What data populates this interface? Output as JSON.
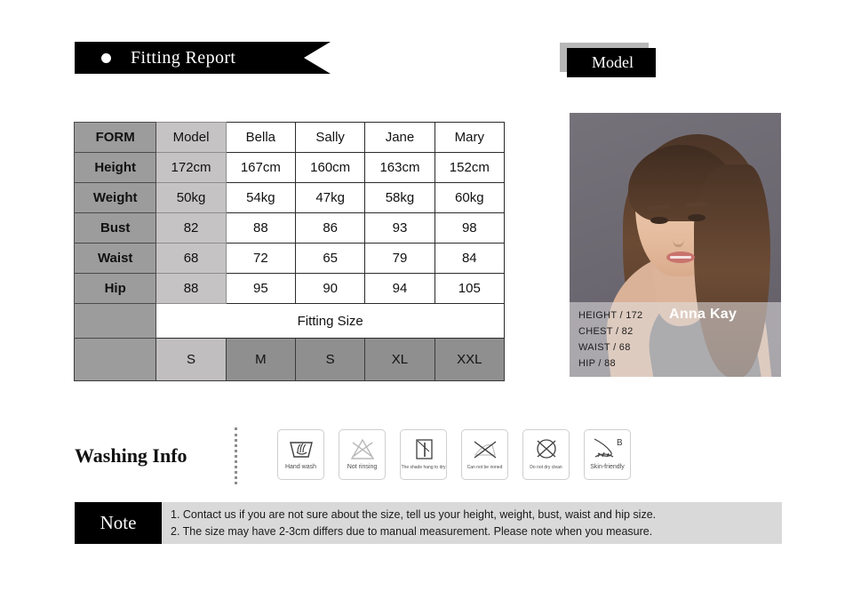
{
  "header": {
    "fitting_report_label": "Fitting Report",
    "model_label": "Model"
  },
  "size_table": {
    "columns": [
      "FORM",
      "Model",
      "Bella",
      "Sally",
      "Jane",
      "Mary"
    ],
    "rows": [
      {
        "label": "Height",
        "values": [
          "172cm",
          "167cm",
          "160cm",
          "163cm",
          "152cm"
        ]
      },
      {
        "label": "Weight",
        "values": [
          "50kg",
          "54kg",
          "47kg",
          "58kg",
          "60kg"
        ]
      },
      {
        "label": "Bust",
        "values": [
          "82",
          "88",
          "86",
          "93",
          "98"
        ]
      },
      {
        "label": "Waist",
        "values": [
          "68",
          "72",
          "65",
          "79",
          "84"
        ]
      },
      {
        "label": "Hip",
        "values": [
          "88",
          "95",
          "90",
          "94",
          "105"
        ]
      }
    ],
    "fitting_size_title": "Fitting Size",
    "fitting_sizes": [
      "S",
      "M",
      "S",
      "XL",
      "XXL"
    ]
  },
  "model_card": {
    "name": "Anna Kay",
    "measurements": [
      "HEIGHT /  172",
      "CHEST /  82",
      "WAIST /  68",
      "HIP /  88"
    ]
  },
  "washing": {
    "title": "Washing Info",
    "icons": [
      {
        "icon": "hand-wash-icon",
        "caption": "Hand wash"
      },
      {
        "icon": "not-rinsing-icon",
        "caption": "Not rinsing"
      },
      {
        "icon": "shade-hang-dry-icon",
        "caption": "The shade hang to dry"
      },
      {
        "icon": "do-not-iron-icon",
        "caption": "Can not be ironed"
      },
      {
        "icon": "do-not-dry-clean-icon",
        "caption": "Do not dry clean"
      },
      {
        "icon": "skin-friendly-icon",
        "caption": "Skin-friendly",
        "badge": "B"
      }
    ]
  },
  "note": {
    "label": "Note",
    "lines": [
      "1. Contact us if you are not sure about the size, tell us your height, weight, bust, waist and hip size.",
      "2. The size may have 2-3cm differs due to manual measurement. Please note when you measure."
    ]
  },
  "colors": {
    "banner": "#000000",
    "label_cell": "#9c9c9c",
    "model_cell": "#c5c3c3",
    "size_cell": "#8f8f8f",
    "note_bg": "#d9d9d9"
  }
}
